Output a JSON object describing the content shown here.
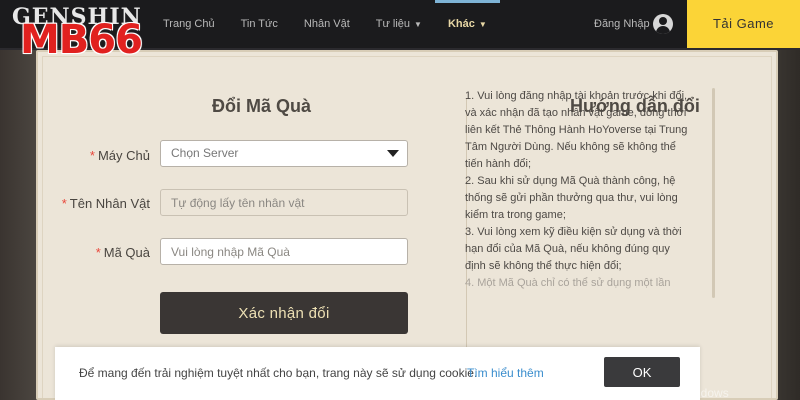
{
  "brand": {
    "logo_text": "GENSHIN",
    "watermark": "MB66"
  },
  "nav": {
    "items": [
      {
        "label": "Trang Chủ",
        "dropdown": false,
        "active": false
      },
      {
        "label": "Tin Tức",
        "dropdown": false,
        "active": false
      },
      {
        "label": "Nhân Vật",
        "dropdown": false,
        "active": false
      },
      {
        "label": "Tư liệu",
        "dropdown": true,
        "active": false
      },
      {
        "label": "Khác",
        "dropdown": true,
        "active": true
      }
    ],
    "login_label": "Đăng Nhập",
    "download_label": "Tải Game"
  },
  "redeem": {
    "title": "Đổi Mã Quà",
    "server_label": "Máy Chủ",
    "server_placeholder": "Chọn Server",
    "name_label": "Tên Nhân Vật",
    "name_placeholder": "Tự động lấy tên nhân vật",
    "code_label": "Mã Quà",
    "code_placeholder": "Vui lòng nhập Mã Quà",
    "submit_label": "Xác nhận đổi"
  },
  "guide": {
    "title": "Hướng dẫn đổi",
    "lines": [
      "1. Vui lòng đăng nhập tài khoản trước khi đổi,",
      "và xác nhận đã tạo nhân vật game, đồng thời",
      "liên kết Thẻ Thông Hành HoYoverse tại Trung",
      "Tâm Người Dùng. Nếu không sẽ không thể",
      "tiến hành đổi;",
      "2. Sau khi sử dụng Mã Quà thành công, hệ",
      "thống sẽ gửi phần thưởng qua thư, vui lòng",
      "kiểm tra trong game;",
      "3. Vui lòng xem kỹ điều kiện sử dụng và thời",
      "hạn đổi của Mã Quà, nếu không đúng quy",
      "định sẽ không thể thực hiện đổi;",
      "4. Một Mã Quà chỉ có thể sử dụng một lần"
    ]
  },
  "cookie": {
    "text": "Để mang đến trải nghiệm tuyệt nhất cho bạn, trang này sẽ sử dụng cookie.",
    "link_label": "Tìm hiểu thêm",
    "ok_label": "OK"
  },
  "system": {
    "activate_text": "Activate Windows"
  }
}
